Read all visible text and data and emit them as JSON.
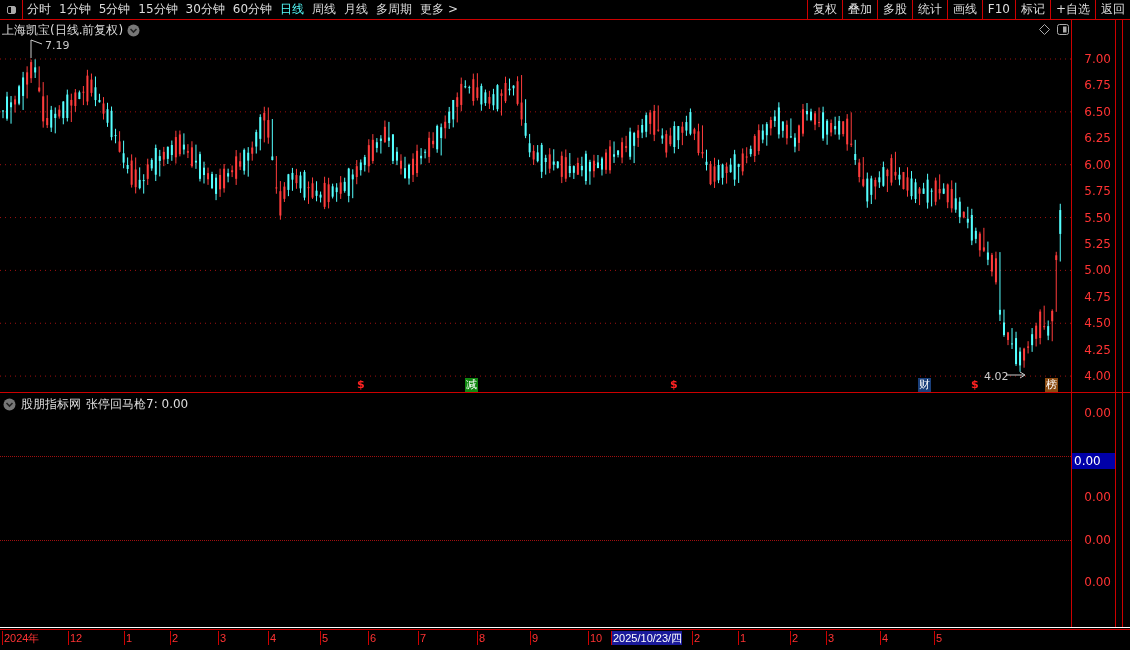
{
  "toolbar": {
    "periods": [
      {
        "label": "分时",
        "selected": false
      },
      {
        "label": "1分钟",
        "selected": false
      },
      {
        "label": "5分钟",
        "selected": false
      },
      {
        "label": "15分钟",
        "selected": false
      },
      {
        "label": "30分钟",
        "selected": false
      },
      {
        "label": "60分钟",
        "selected": false
      },
      {
        "label": "日线",
        "selected": true
      },
      {
        "label": "周线",
        "selected": false
      },
      {
        "label": "月线",
        "selected": false
      },
      {
        "label": "多周期",
        "selected": false
      },
      {
        "label": "更多 >",
        "selected": false
      }
    ],
    "actions": [
      "复权",
      "叠加",
      "多股",
      "统计",
      "画线",
      "F10",
      "标记",
      "+自选",
      "返回"
    ]
  },
  "main_chart": {
    "title": "上海凯宝(日线.前复权)",
    "high_label": "7.19",
    "low_label": "4.02",
    "price_axis": [
      "7.00",
      "6.75",
      "6.50",
      "6.25",
      "6.00",
      "5.75",
      "5.50",
      "5.25",
      "5.00",
      "4.75",
      "4.50",
      "4.25",
      "4.00"
    ],
    "events": [
      {
        "kind": "signal",
        "label": "$"
      },
      {
        "kind": "badge",
        "label": "减",
        "color": "#118811"
      },
      {
        "kind": "signal",
        "label": "$"
      },
      {
        "kind": "badge",
        "label": "财",
        "color": "#1a3f7a"
      },
      {
        "kind": "signal",
        "label": "$"
      },
      {
        "kind": "badge",
        "label": "榜",
        "color": "#8a4a10"
      }
    ]
  },
  "indicator": {
    "source": "股朋指标网",
    "formula": "张停回马枪7: 0.00",
    "axis": [
      "0.00",
      "0.00",
      "0.00",
      "0.00"
    ],
    "cursor_value": "0.00"
  },
  "time_axis": {
    "labels": [
      {
        "label": "2024年",
        "kind": "tick"
      },
      {
        "label": "12",
        "kind": "tick"
      },
      {
        "label": "1",
        "kind": "tick"
      },
      {
        "label": "2",
        "kind": "tick"
      },
      {
        "label": "3",
        "kind": "tick"
      },
      {
        "label": "4",
        "kind": "tick"
      },
      {
        "label": "5",
        "kind": "tick"
      },
      {
        "label": "6",
        "kind": "tick"
      },
      {
        "label": "7",
        "kind": "tick"
      },
      {
        "label": "8",
        "kind": "tick"
      },
      {
        "label": "9",
        "kind": "tick"
      },
      {
        "label": "10",
        "kind": "tick"
      },
      {
        "label": "2025/10/23/四",
        "kind": "cursor"
      },
      {
        "label": "2",
        "kind": "tick"
      },
      {
        "label": "1",
        "kind": "tick"
      },
      {
        "label": "2",
        "kind": "tick"
      },
      {
        "label": "3",
        "kind": "tick"
      },
      {
        "label": "4",
        "kind": "tick"
      },
      {
        "label": "5",
        "kind": "tick"
      }
    ]
  }
}
